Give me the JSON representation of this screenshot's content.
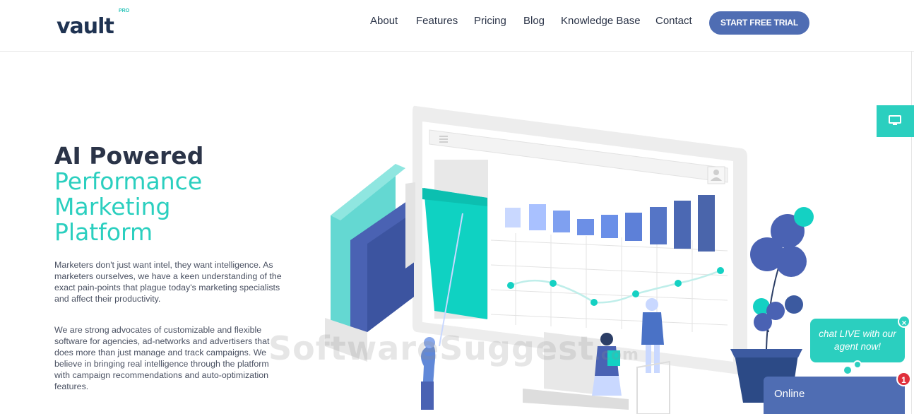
{
  "header": {
    "logo": {
      "text": "vault",
      "badge": "PRO"
    },
    "nav": [
      {
        "label": "About"
      },
      {
        "label": "Features"
      },
      {
        "label": "Pricing"
      },
      {
        "label": "Blog"
      },
      {
        "label": "Knowledge Base"
      },
      {
        "label": "Contact"
      }
    ],
    "cta_label": "START FREE TRIAL"
  },
  "hero": {
    "title_line1": "AI Powered",
    "title_line2": "Performance",
    "title_line3": "Marketing",
    "title_line4": "Platform",
    "paragraph1": "Marketers don't just want intel, they want intelligence. As marketers ourselves, we have a keen understanding of the exact pain-points that plague today's marketing specialists and affect their productivity.",
    "paragraph2": "We are strong advocates of customizable and flexible software for agencies, ad-networks and advertisers that does more than just manage and track campaigns. We believe in bringing real intelligence through the platform with campaign recommendations and auto-optimization features."
  },
  "watermark": {
    "text": "SoftwareSuggest",
    "suffix": ".com"
  },
  "widgets": {
    "side_tab_icon": "monitor-icon",
    "chat_text": "chat LIVE with our agent now!",
    "chat_close": "×",
    "online_label": "Online",
    "notification_count": "1"
  },
  "colors": {
    "brand_dark": "#1f3352",
    "teal": "#2bcfbf",
    "blue": "#4f6db3",
    "badge_red": "#e0303c"
  }
}
